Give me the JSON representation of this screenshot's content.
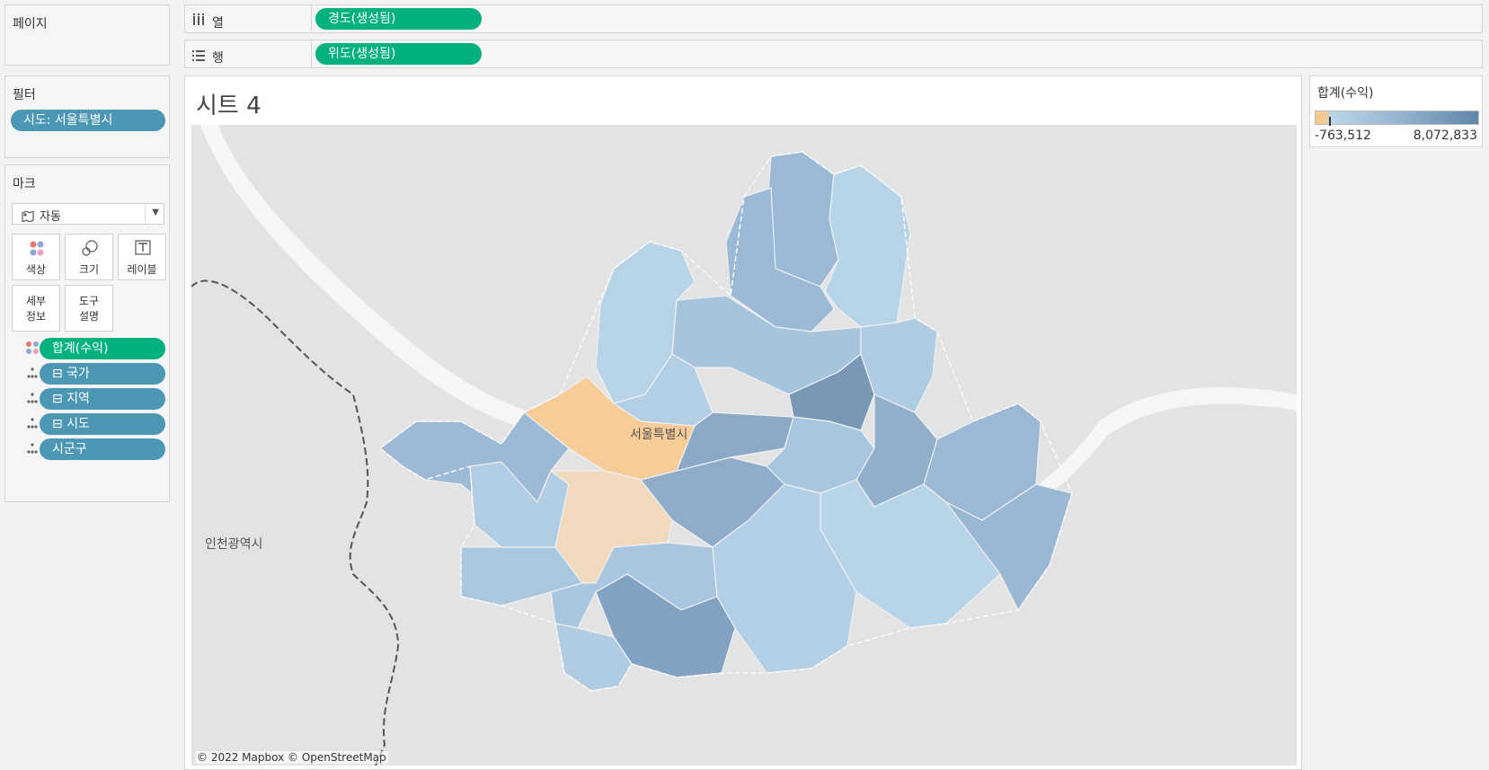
{
  "pages_panel": {
    "title": "페이지"
  },
  "columns_shelf": {
    "label": "열",
    "icon": "columns-icon",
    "pill": "경도(생성됨)"
  },
  "rows_shelf": {
    "label": "행",
    "icon": "rows-icon",
    "pill": "위도(생성됨)"
  },
  "filters_panel": {
    "title": "필터",
    "pill": "시도: 서울특별시"
  },
  "marks_panel": {
    "title": "마크",
    "type_icon": "map-mark-icon",
    "type_value": "자동",
    "buttons": {
      "color": "색상",
      "size": "크기",
      "label": "레이블",
      "detail_line1": "세부",
      "detail_line2": "정보",
      "tooltip_line1": "도구",
      "tooltip_line2": "설명"
    },
    "cards": [
      {
        "icon": "color-dots-icon",
        "text": "합계(수익)"
      },
      {
        "icon": "detail-icon",
        "text": "⊟ 국가"
      },
      {
        "icon": "detail-icon",
        "text": "⊟ 지역"
      },
      {
        "icon": "detail-icon",
        "text": "⊟ 시도"
      },
      {
        "icon": "detail-icon",
        "text": "시군구"
      }
    ]
  },
  "sheet": {
    "title": "시트 4",
    "map_labels": {
      "city": "서울특별시",
      "neighbor": "인천광역시"
    },
    "attribution": "© 2022 Mapbox © OpenStreetMap"
  },
  "legend": {
    "title": "합계(수익)",
    "min": "-763,512",
    "max": "8,072,833"
  },
  "colors": {
    "green_pill": "#00b180",
    "blue_pill": "#4b97b4",
    "negative": "#f5c990",
    "positive_low": "#b9d6e8",
    "positive_high": "#5f86ab"
  }
}
